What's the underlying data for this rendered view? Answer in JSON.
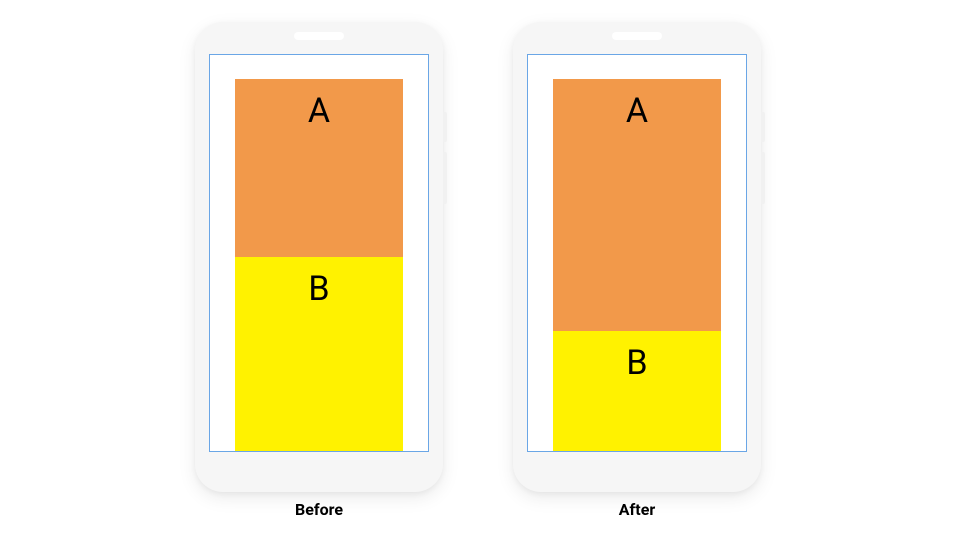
{
  "diagram": {
    "colors": {
      "blockA": "#f2994a",
      "blockB": "#fff200",
      "phoneBody": "#f6f6f6",
      "screenBorder": "#6aa6e6"
    },
    "phones": [
      {
        "caption": "Before",
        "blocks": {
          "a": "A",
          "b": "B"
        },
        "ratio": {
          "a": 0.48,
          "b": 0.52
        }
      },
      {
        "caption": "After",
        "blocks": {
          "a": "A",
          "b": "B"
        },
        "ratio": {
          "a": 0.68,
          "b": 0.32
        }
      }
    ]
  }
}
